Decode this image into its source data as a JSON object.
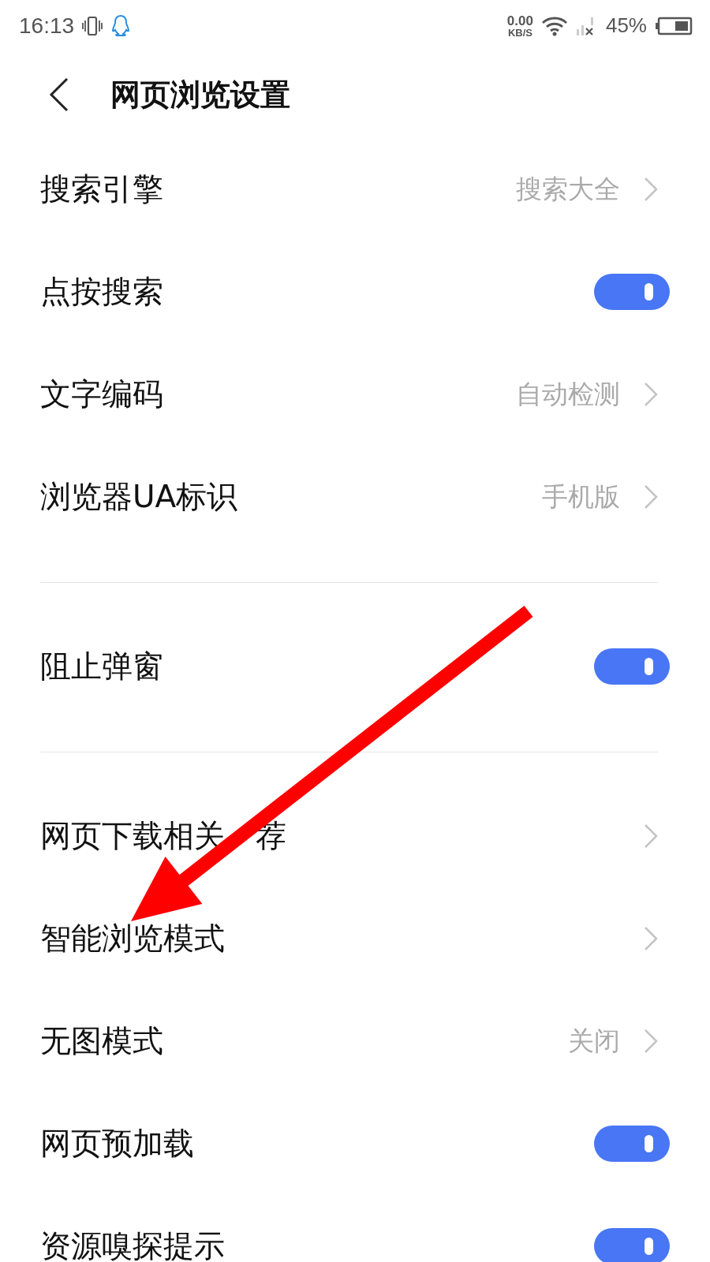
{
  "status_bar": {
    "time": "16:13",
    "speed": "0.00",
    "speed_unit": "KB/S",
    "battery": "45%"
  },
  "header": {
    "title": "网页浏览设置"
  },
  "sections": [
    {
      "rows": [
        {
          "kind": "value",
          "label": "搜索引擎",
          "value": "搜索大全"
        },
        {
          "kind": "toggle",
          "label": "点按搜索",
          "on": true
        },
        {
          "kind": "value",
          "label": "文字编码",
          "value": "自动检测"
        },
        {
          "kind": "value",
          "label": "浏览器UA标识",
          "value": "手机版"
        }
      ]
    },
    {
      "rows": [
        {
          "kind": "toggle",
          "label": "阻止弹窗",
          "on": true
        }
      ]
    },
    {
      "rows": [
        {
          "kind": "link",
          "label": "网页下载相关",
          "label_after_arrow": "荐"
        },
        {
          "kind": "link",
          "label": "智能浏览模式"
        },
        {
          "kind": "value",
          "label": "无图模式",
          "value": "关闭"
        },
        {
          "kind": "toggle",
          "label": "网页预加载",
          "on": true
        },
        {
          "kind": "toggle",
          "label": "资源嗅探提示",
          "on": true
        }
      ]
    }
  ]
}
